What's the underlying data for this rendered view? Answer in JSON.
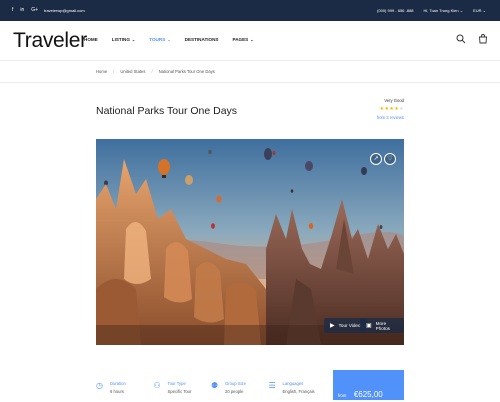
{
  "topbar": {
    "social": [
      "f",
      "in",
      "G+"
    ],
    "email": "travelerwp@gmail.com",
    "phone": "(000) 999 - 656 -888",
    "user": "Hi, Toan Trung Kien",
    "currency": "EUR"
  },
  "nav": {
    "logo": "Traveler",
    "items": [
      {
        "label": "HOME",
        "has_menu": false
      },
      {
        "label": "LISTING",
        "has_menu": true
      },
      {
        "label": "TOURS",
        "has_menu": true
      },
      {
        "label": "DESTINATIONS",
        "has_menu": false
      },
      {
        "label": "PAGES",
        "has_menu": true
      }
    ],
    "active": "TOURS",
    "icons": [
      "search-icon",
      "cart-icon"
    ]
  },
  "breadcrumb": [
    "Home",
    "United States",
    "National Parks Tour One Days"
  ],
  "tour": {
    "title": "National Parks Tour One Days",
    "rating_text": "Very Good",
    "stars": 4,
    "reviews": "from 3 reviews"
  },
  "hero": {
    "video_label": "Tour Video",
    "photos_label": "More Photos",
    "icons": [
      "share-icon",
      "heart-icon"
    ]
  },
  "info": [
    {
      "icon": "clock-icon",
      "label": "Duration",
      "value": "6 hours"
    },
    {
      "icon": "tour-type-icon",
      "label": "Tour Type",
      "value": "Specific Tour"
    },
    {
      "icon": "group-icon",
      "label": "Group Size",
      "value": "20 people"
    },
    {
      "icon": "language-icon",
      "label": "Languages",
      "value": "English, Français"
    }
  ],
  "price": {
    "prefix": "from",
    "amount": "€625,00"
  },
  "colors": {
    "topbar": "#1b2b45",
    "accent": "#5191fa",
    "stars": "#f7b400"
  }
}
